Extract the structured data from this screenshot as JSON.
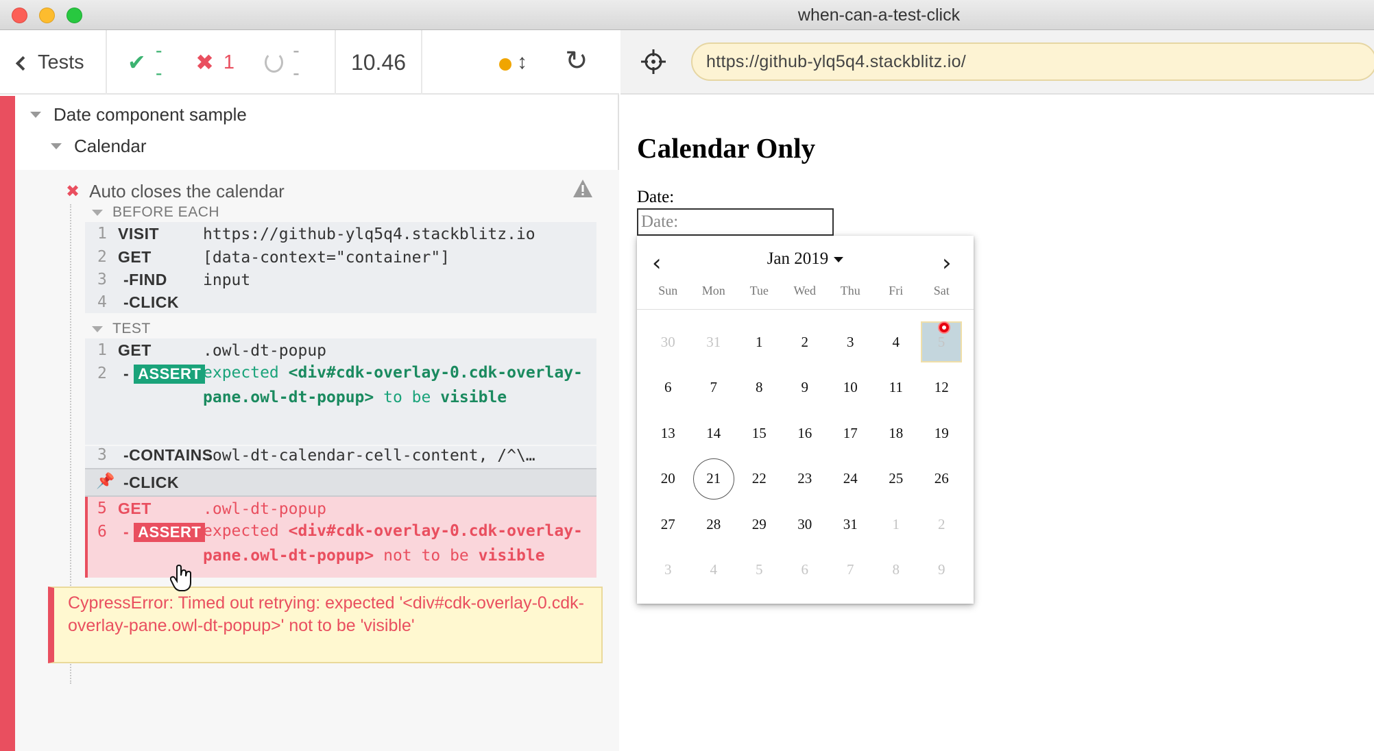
{
  "window": {
    "title": "when-can-a-test-click"
  },
  "header": {
    "tests_label": "Tests",
    "passed": "--",
    "failed": "1",
    "pending": "--",
    "duration": "10.46"
  },
  "suites": {
    "root": "Date component sample",
    "child": "Calendar",
    "test": "Auto closes the calendar"
  },
  "hooks": {
    "before_each_label": "BEFORE EACH",
    "test_label": "TEST"
  },
  "before_each_cmds": [
    {
      "num": "1",
      "name": "VISIT",
      "msg": "https://github-ylq5q4.stackblitz.io"
    },
    {
      "num": "2",
      "name": "GET",
      "msg": "[data-context=\"container\"]"
    },
    {
      "num": "3",
      "name": "-FIND",
      "msg": "input"
    },
    {
      "num": "4",
      "name": "-CLICK",
      "msg": ""
    }
  ],
  "test_cmds": [
    {
      "num": "1",
      "name": "GET",
      "msg": ".owl-dt-popup"
    },
    {
      "num": "2",
      "name": "-",
      "badge": "ASSERT",
      "msg_prefix": "expected",
      "msg_subject": "<div#cdk-overlay-0.cdk-overlay-pane.owl-dt-popup>",
      "msg_mid": "to be",
      "msg_end": "visible"
    },
    {
      "num": "3",
      "name": "-CONTAINS",
      "msg": ".owl-dt-calendar-cell-content, /^\\…"
    },
    {
      "num": "",
      "name": "-CLICK",
      "msg": ""
    },
    {
      "num": "5",
      "name": "GET",
      "msg": ".owl-dt-popup"
    },
    {
      "num": "6",
      "name": "-",
      "badge": "ASSERT",
      "msg_prefix": "expected",
      "msg_subject": "<div#cdk-overlay-0.cdk-overlay-pane.owl-dt-popup>",
      "msg_mid": "not to",
      "msg_mid2": "be",
      "msg_end": "visible"
    }
  ],
  "error": {
    "text": "CypressError: Timed out retrying: expected '<div#cdk-overlay-0.cdk-overlay-pane.owl-dt-popup>' not to be 'visible'"
  },
  "aut": {
    "url": "https://github-ylq5q4.stackblitz.io/",
    "heading": "Calendar Only",
    "date_label": "Date:",
    "input_placeholder": "Date:"
  },
  "calendar": {
    "period": "Jan 2019",
    "prev_icon": "chevron-left-icon",
    "next_icon": "chevron-right-icon",
    "weekdays": [
      "Sun",
      "Mon",
      "Tue",
      "Wed",
      "Thu",
      "Fri",
      "Sat"
    ],
    "weeks": [
      [
        "30",
        "31",
        "1",
        "2",
        "3",
        "4",
        "5"
      ],
      [
        "6",
        "7",
        "8",
        "9",
        "10",
        "11",
        "12"
      ],
      [
        "13",
        "14",
        "15",
        "16",
        "17",
        "18",
        "19"
      ],
      [
        "20",
        "21",
        "22",
        "23",
        "24",
        "25",
        "26"
      ],
      [
        "27",
        "28",
        "29",
        "30",
        "31",
        "1",
        "2"
      ],
      [
        "3",
        "4",
        "5",
        "6",
        "7",
        "8",
        "9"
      ]
    ],
    "today": "21",
    "selected": "5"
  },
  "colors": {
    "fail": "#e94f5f",
    "pass": "#3cb371",
    "assert_green": "#1aa37a",
    "url_bg": "#fdf3d3",
    "error_bg": "#fff8d0"
  }
}
